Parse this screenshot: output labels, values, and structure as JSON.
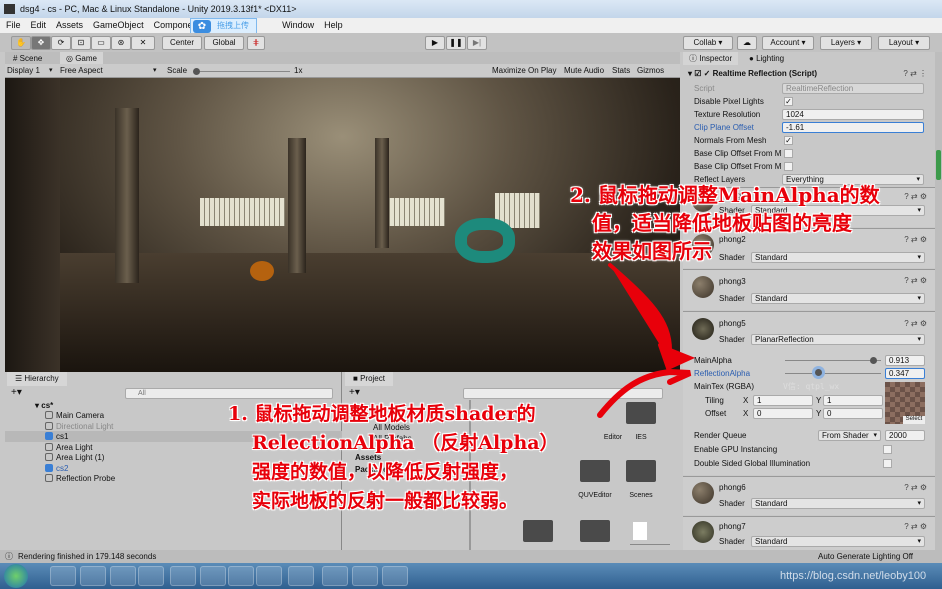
{
  "window": {
    "title": "dsg4 - cs - PC, Mac & Linux Standalone - Unity 2019.3.13f1* <DX11>"
  },
  "menu": [
    "File",
    "Edit",
    "Assets",
    "GameObject",
    "Component",
    "Window",
    "Help"
  ],
  "cloud_tooltip": "拖拽上传",
  "toolbar": {
    "center": "Center",
    "global": "Global",
    "collab": "Collab ▾",
    "account": "Account",
    "layers": "Layers",
    "layout": "Layout",
    "play": "▶",
    "pause": "❚❚",
    "step": "▶|"
  },
  "tabs": {
    "scene": "Scene",
    "game": "Game",
    "inspector": "Inspector",
    "lighting": "Lighting"
  },
  "gamebar": {
    "display": "Display 1",
    "aspect": "Free Aspect",
    "scale_label": "Scale",
    "scale_value": "1x",
    "maximize": "Maximize On Play",
    "mute": "Mute Audio",
    "stats": "Stats",
    "gizmos": "Gizmos"
  },
  "hierarchy": {
    "title": "Hierarchy",
    "search": "All",
    "scene": "cs*",
    "items": [
      "Main Camera",
      "Directional Light",
      "cs1",
      "Area Light",
      "Area Light (1)",
      "cs2",
      "Reflection Probe"
    ]
  },
  "project": {
    "title": "Project",
    "tree": [
      "All Models",
      "All Prefabs",
      "Assets",
      "Packages"
    ],
    "folders": [
      "Editor",
      "IES",
      "QUVEditor",
      "Scenes"
    ]
  },
  "inspector": {
    "component": "Realtime Reflection (Script)",
    "script_label": "Script",
    "script_value": "RealtimeReflection",
    "disable_pixel_lights": "Disable Pixel Lights",
    "texture_resolution_label": "Texture Resolution",
    "texture_resolution": "1024",
    "clip_plane_offset_label": "Clip Plane Offset",
    "clip_plane_offset": "-1.61",
    "normals_from_mesh": "Normals From Mesh",
    "base_clip_1": "Base Clip Offset From M",
    "base_clip_2": "Base Clip Offset From M",
    "reflect_layers_label": "Reflect Layers",
    "reflect_layers": "Everything",
    "shader_label": "Shader",
    "materials": [
      {
        "name": "phong1",
        "shader": "Standard"
      },
      {
        "name": "phong2",
        "shader": "Standard"
      },
      {
        "name": "phong3",
        "shader": "Standard"
      },
      {
        "name": "phong5",
        "shader": "PlanarReflection"
      },
      {
        "name": "phong6",
        "shader": "Standard"
      },
      {
        "name": "phong7",
        "shader": "Standard"
      }
    ],
    "main_alpha_label": "MainAlpha",
    "main_alpha": "0.913",
    "main_alpha_value": 0.913,
    "reflection_alpha_label": "ReflectionAlpha",
    "reflection_alpha": "0.347",
    "reflection_alpha_value": 0.347,
    "maintex_label": "MainTex (RGBA)",
    "tiling_label": "Tiling",
    "offset_label": "Offset",
    "x": "X",
    "y": "Y",
    "tiling_x": "1",
    "tiling_y": "1",
    "offset_x": "0",
    "offset_y": "0",
    "select": "Select",
    "render_queue_label": "Render Queue",
    "render_queue_mode": "From Shader",
    "render_queue": "2000",
    "gpu_instancing": "Enable GPU Instancing",
    "double_sided": "Double Sided Global Illumination",
    "watermark": "V信: qtpl_wx"
  },
  "status": {
    "message": "Rendering finished in 179.148 seconds",
    "lighting": "Auto Generate Lighting Off"
  },
  "annotations": {
    "a2": [
      "2. 鼠标拖动调整MainAlpha的数",
      "值，适当降低地板贴图的亮度",
      "效果如图所示"
    ],
    "a1": [
      "1. 鼠标拖动调整地板材质shader的",
      "RelectionAlpha （反射Alpha）",
      "强度的数值，以降低反射强度，",
      "实际地板的反射一般都比较弱。"
    ]
  },
  "taskbar": {
    "watermark": "https://blog.csdn.net/leoby100"
  },
  "colors": {
    "annotation": "#e8000a",
    "link_blue": "#2a5db0"
  }
}
